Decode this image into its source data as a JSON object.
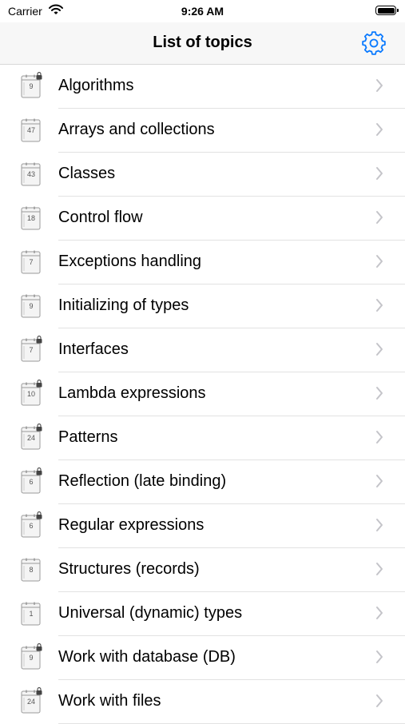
{
  "status_bar": {
    "carrier": "Carrier",
    "time": "9:26 AM"
  },
  "nav": {
    "title": "List of topics",
    "settings_icon": "gear-icon",
    "accent_color": "#0a7aff"
  },
  "topics": [
    {
      "label": "Algorithms",
      "count": "9",
      "locked": true
    },
    {
      "label": "Arrays and collections",
      "count": "47",
      "locked": false
    },
    {
      "label": "Classes",
      "count": "43",
      "locked": false
    },
    {
      "label": "Control flow",
      "count": "18",
      "locked": false
    },
    {
      "label": "Exceptions handling",
      "count": "7",
      "locked": false
    },
    {
      "label": "Initializing of types",
      "count": "9",
      "locked": false
    },
    {
      "label": "Interfaces",
      "count": "7",
      "locked": true
    },
    {
      "label": "Lambda expressions",
      "count": "10",
      "locked": true
    },
    {
      "label": "Patterns",
      "count": "24",
      "locked": true
    },
    {
      "label": "Reflection (late binding)",
      "count": "6",
      "locked": true
    },
    {
      "label": "Regular expressions",
      "count": "6",
      "locked": true
    },
    {
      "label": "Structures (records)",
      "count": "8",
      "locked": false
    },
    {
      "label": "Universal (dynamic) types",
      "count": "1",
      "locked": false
    },
    {
      "label": "Work with database (DB)",
      "count": "9",
      "locked": true
    },
    {
      "label": "Work with files",
      "count": "24",
      "locked": true
    }
  ]
}
